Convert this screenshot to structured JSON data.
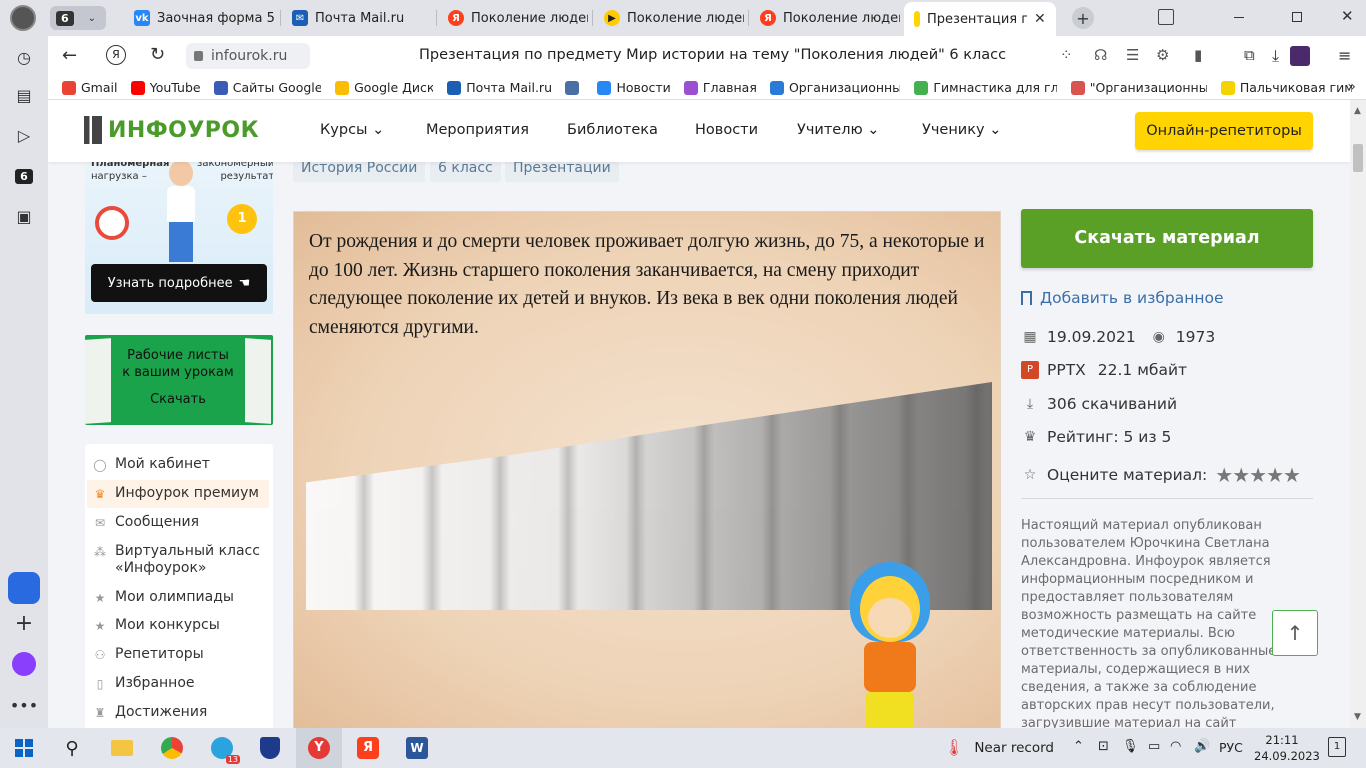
{
  "tabs": [
    {
      "label": "6",
      "icon": "tab-counter"
    },
    {
      "label": "Заочная форма 5 к",
      "icon": "vk-icon"
    },
    {
      "label": "Почта Mail.ru",
      "icon": "mail-icon"
    },
    {
      "label": "Поколение людей",
      "icon": "yandex-icon"
    },
    {
      "label": "Поколение людей",
      "icon": "yandex-play-icon"
    },
    {
      "label": "Поколение людей",
      "icon": "yandex-icon"
    },
    {
      "label": "Презентация по",
      "icon": "infourok-icon"
    }
  ],
  "address": {
    "domain": "infourok.ru",
    "title": "Презентация по предмету Мир истории на тему \"Поколения людей\" 6 класс"
  },
  "bookmarks": [
    {
      "label": "Gmail",
      "color": "#ea4335"
    },
    {
      "label": "YouTube",
      "color": "#ff0000"
    },
    {
      "label": "Сайты Google",
      "color": "#3b5bb5"
    },
    {
      "label": "Google Диск",
      "color": "#fbbc04"
    },
    {
      "label": "Почта Mail.ru",
      "color": "#1a5fb4"
    },
    {
      "label": "",
      "color": "#4a6fa5"
    },
    {
      "label": "Новости",
      "color": "#2787f5"
    },
    {
      "label": "Главная",
      "color": "#9c4fd0"
    },
    {
      "label": "Организационны",
      "color": "#2a7ad8"
    },
    {
      "label": "Гимнастика для гл",
      "color": "#45b050"
    },
    {
      "label": "\"Организационны",
      "color": "#d9534f"
    },
    {
      "label": "Пальчиковая гим",
      "color": "#f5d300"
    }
  ],
  "site": {
    "logo": "ИНФОУРОК",
    "nav": [
      "Курсы",
      "Мероприятия",
      "Библиотека",
      "Новости",
      "Учителю",
      "Ученику"
    ],
    "cta": "Онлайн-репетиторы"
  },
  "promo1": {
    "line1": "Планомерная",
    "line2": "нагрузка –",
    "line3": "закономерный",
    "line4": "результат",
    "button": "Узнать подробнее"
  },
  "promo2": {
    "line1": "Рабочие листы",
    "line2": "к вашим урокам",
    "button": "Скачать"
  },
  "menu": [
    {
      "label": "Мой кабинет",
      "icon": "user-icon"
    },
    {
      "label": "Инфоурок премиум",
      "icon": "crown-icon"
    },
    {
      "label": "Сообщения",
      "icon": "mail-icon"
    },
    {
      "label": "Виртуальный класс «Инфоурок»",
      "icon": "class-icon"
    },
    {
      "label": "Мои олимпиады",
      "icon": "star-icon"
    },
    {
      "label": "Мои конкурсы",
      "icon": "star-icon"
    },
    {
      "label": "Репетиторы",
      "icon": "people-icon"
    },
    {
      "label": "Избранное",
      "icon": "bookmark-icon"
    },
    {
      "label": "Достижения",
      "icon": "trophy-icon"
    }
  ],
  "tags": [
    "История России",
    "6 класс",
    "Презентации"
  ],
  "slide": {
    "text": "От рождения и до смерти человек проживает долгую жизнь, до 75, а некоторые и до 100 лет. Жизнь старшего поколения заканчивается, на смену приходит следующее поколение их детей и внуков. Из века в век одни поколения людей сменяются другими."
  },
  "material": {
    "download": "Скачать материал",
    "favorite": "Добавить в избранное",
    "date": "19.09.2021",
    "views": "1973",
    "format": "PPTX",
    "size": "22.1 мбайт",
    "downloads": "306 скачиваний",
    "rating": "Рейтинг: 5 из 5",
    "rate_label": "Оцените материал:",
    "stars": 5,
    "disclaimer": "Настоящий материал опубликован пользователем Юрочкина Светлана Александровна. Инфоурок является информационным посредником и предоставляет пользователям возможность размещать на сайте методические материалы. Всю ответственность за опубликованные материалы, содержащиеся в них сведения, а также за соблюдение авторских прав несут пользователи, загрузившие материал на сайт"
  },
  "taskbar": {
    "weather": "Near record",
    "lang": "РУС",
    "time": "21:11",
    "date": "24.09.2023",
    "telegram_badge": "13",
    "notif": "1"
  },
  "colors": {
    "green": "#5aa026",
    "yellow": "#ffd400",
    "accent": "#3a6ea8"
  }
}
